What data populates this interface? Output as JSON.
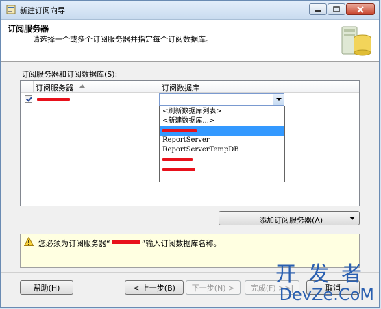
{
  "window": {
    "title": "新建订阅向导"
  },
  "header": {
    "title": "订阅服务器",
    "description": "请选择一个或多个订阅服务器并指定每个订阅数据库。"
  },
  "grid": {
    "section_label": "订阅服务器和订阅数据库(S):",
    "columns": [
      "订阅服务器",
      "订阅数据库"
    ],
    "row": {
      "checked": true,
      "database_value": ""
    }
  },
  "dropdown": {
    "items": [
      "<刷新数据库列表>",
      "<新建数据库...>",
      "",
      "ReportServer",
      "ReportServerTempDB",
      "",
      ""
    ],
    "selected_index": 2
  },
  "add_subscriber_button": "添加订阅服务器(A)",
  "message": {
    "part1": "您必须为订阅服务器“",
    "part2": "”输入订阅数据库名称。"
  },
  "buttons": {
    "help": "帮助(H)",
    "back": "< 上一步(B)",
    "next": "下一步(N) >",
    "finish": "完成(F) >>|",
    "cancel": "取消"
  },
  "watermark": {
    "line1": "开发者",
    "line2": "DevZe.CoM"
  }
}
